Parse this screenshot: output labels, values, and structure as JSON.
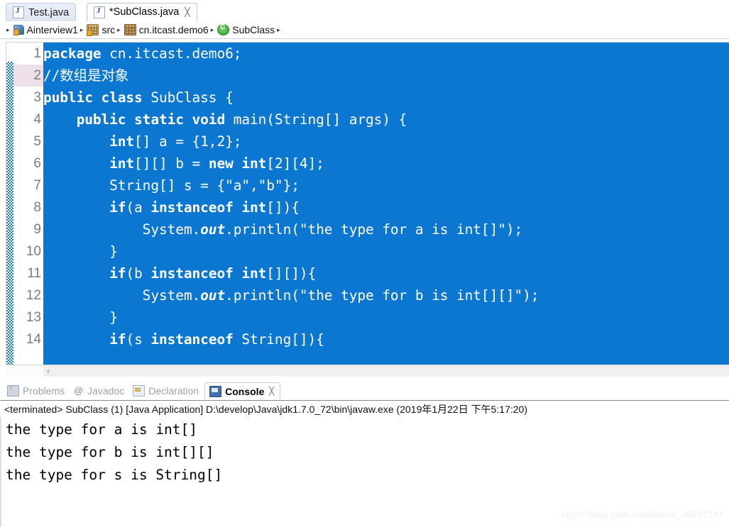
{
  "editor_tabs": [
    {
      "label": "Test.java",
      "icon": "java-file-icon",
      "active": false,
      "closable": false
    },
    {
      "label": "*SubClass.java",
      "icon": "java-file-icon",
      "active": true,
      "closable": true,
      "close_glyph": "╳"
    }
  ],
  "breadcrumb": {
    "lead_arrow": "▸",
    "separator": "▸",
    "items": [
      {
        "label": "Ainterview1",
        "icon": "java-project-icon"
      },
      {
        "label": "src",
        "icon": "source-folder-icon"
      },
      {
        "label": "cn.itcast.demo6",
        "icon": "package-icon"
      },
      {
        "label": "SubClass",
        "icon": "class-icon"
      }
    ]
  },
  "code_editor": {
    "selection_color": "#0c77d0",
    "selected_text_color": "#ffffff",
    "current_line_marker_color": "#eee0ea",
    "change_bar_color": "#1a7fd4",
    "highlighted_line": 2,
    "lines": [
      {
        "num": "1",
        "tokens": [
          {
            "t": "package",
            "s": "kw"
          },
          {
            "t": " cn.itcast.demo6;",
            "s": ""
          }
        ]
      },
      {
        "num": "2",
        "tokens": [
          {
            "t": "//数组是对象",
            "s": ""
          }
        ]
      },
      {
        "num": "3",
        "tokens": [
          {
            "t": "public class",
            "s": "kw"
          },
          {
            "t": " SubClass {",
            "s": ""
          }
        ]
      },
      {
        "num": "4",
        "tokens": [
          {
            "t": "    ",
            "s": ""
          },
          {
            "t": "public static void",
            "s": "kw"
          },
          {
            "t": " main(String[] args) {",
            "s": ""
          }
        ]
      },
      {
        "num": "5",
        "tokens": [
          {
            "t": "        ",
            "s": ""
          },
          {
            "t": "int",
            "s": "kw"
          },
          {
            "t": "[] a = {1,2};",
            "s": ""
          }
        ]
      },
      {
        "num": "6",
        "tokens": [
          {
            "t": "        ",
            "s": ""
          },
          {
            "t": "int",
            "s": "kw"
          },
          {
            "t": "[][] b = ",
            "s": ""
          },
          {
            "t": "new int",
            "s": "kw"
          },
          {
            "t": "[2][4];",
            "s": ""
          }
        ]
      },
      {
        "num": "7",
        "tokens": [
          {
            "t": "        String[] s = {\"a\",\"b\"};",
            "s": ""
          }
        ]
      },
      {
        "num": "8",
        "tokens": [
          {
            "t": "        ",
            "s": ""
          },
          {
            "t": "if",
            "s": "kw"
          },
          {
            "t": "(a ",
            "s": ""
          },
          {
            "t": "instanceof int",
            "s": "kw"
          },
          {
            "t": "[]){",
            "s": ""
          }
        ]
      },
      {
        "num": "9",
        "tokens": [
          {
            "t": "            System.",
            "s": ""
          },
          {
            "t": "out",
            "s": "stat"
          },
          {
            "t": ".println(\"the type for a is int[]\");",
            "s": ""
          }
        ]
      },
      {
        "num": "10",
        "tokens": [
          {
            "t": "        }",
            "s": ""
          }
        ]
      },
      {
        "num": "11",
        "tokens": [
          {
            "t": "        ",
            "s": ""
          },
          {
            "t": "if",
            "s": "kw"
          },
          {
            "t": "(b ",
            "s": ""
          },
          {
            "t": "instanceof int",
            "s": "kw"
          },
          {
            "t": "[][]){",
            "s": ""
          }
        ]
      },
      {
        "num": "12",
        "tokens": [
          {
            "t": "            System.",
            "s": ""
          },
          {
            "t": "out",
            "s": "stat"
          },
          {
            "t": ".println(\"the type for b is int[][]\");",
            "s": ""
          }
        ]
      },
      {
        "num": "13",
        "tokens": [
          {
            "t": "        }",
            "s": ""
          }
        ]
      },
      {
        "num": "14",
        "tokens": [
          {
            "t": "        ",
            "s": ""
          },
          {
            "t": "if",
            "s": "kw"
          },
          {
            "t": "(s ",
            "s": ""
          },
          {
            "t": "instanceof",
            "s": "kw"
          },
          {
            "t": " String[]){",
            "s": ""
          }
        ]
      }
    ]
  },
  "editor_scrollbar": {
    "left_arrow_glyph": "‹"
  },
  "view_tabs": [
    {
      "label": "Problems",
      "icon": "problems-icon",
      "active": false,
      "closable": false
    },
    {
      "label": "Javadoc",
      "icon": "javadoc-icon",
      "active": false,
      "closable": false
    },
    {
      "label": "Declaration",
      "icon": "declaration-icon",
      "active": false,
      "closable": false
    },
    {
      "label": "Console",
      "icon": "console-icon",
      "active": true,
      "closable": true,
      "close_glyph": "╳"
    }
  ],
  "console": {
    "launch_line": "<terminated> SubClass (1) [Java Application] D:\\develop\\Java\\jdk1.7.0_72\\bin\\javaw.exe (2019年1月22日 下午5:17:20)",
    "output_lines": [
      "the type for a is int[]",
      "the type for b is int[][]",
      "the type for s is String[]"
    ]
  },
  "watermark": {
    "text": "https://blog.csdn.net/weixin_40807247"
  }
}
